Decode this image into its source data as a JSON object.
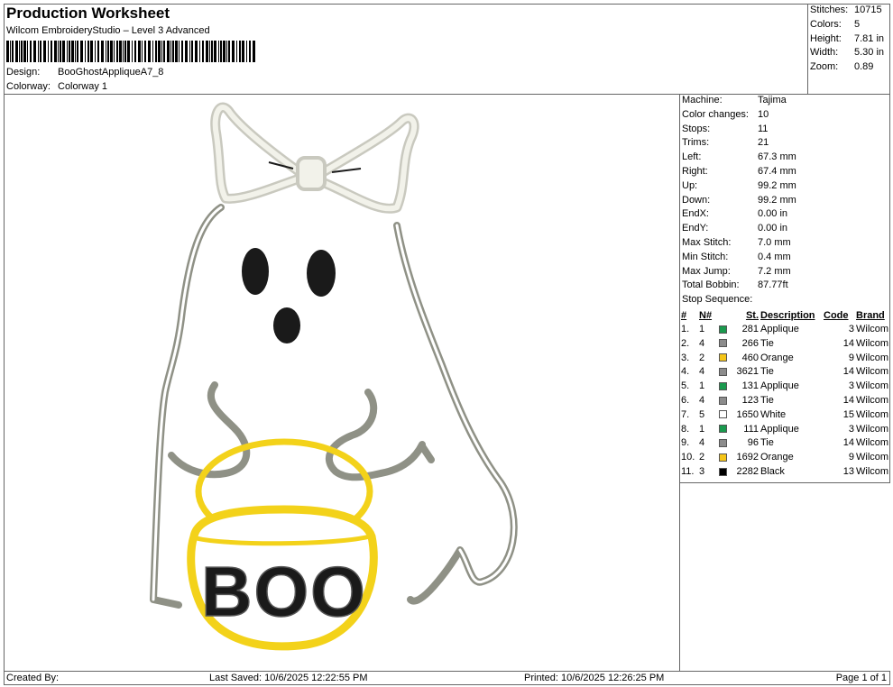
{
  "header": {
    "title": "Production Worksheet",
    "software": "Wilcom EmbroideryStudio – Level 3 Advanced",
    "design_label": "Design:",
    "design_value": "BooGhostAppliqueA7_8",
    "colorway_label": "Colorway:",
    "colorway_value": "Colorway 1"
  },
  "summary": [
    {
      "label": "Stitches:",
      "value": "10715"
    },
    {
      "label": "Colors:",
      "value": "5"
    },
    {
      "label": "Height:",
      "value": "7.81 in"
    },
    {
      "label": "Width:",
      "value": "5.30 in"
    },
    {
      "label": "Zoom:",
      "value": "0.89"
    }
  ],
  "machine_info": [
    {
      "label": "Machine:",
      "value": "Tajima"
    },
    {
      "label": "Color changes:",
      "value": "10"
    },
    {
      "label": "Stops:",
      "value": "11"
    },
    {
      "label": "Trims:",
      "value": "21"
    },
    {
      "label": "Left:",
      "value": "67.3 mm"
    },
    {
      "label": "Right:",
      "value": "67.4 mm"
    },
    {
      "label": "Up:",
      "value": "99.2 mm"
    },
    {
      "label": "Down:",
      "value": "99.2 mm"
    },
    {
      "label": "EndX:",
      "value": "0.00 in"
    },
    {
      "label": "EndY:",
      "value": "0.00 in"
    },
    {
      "label": "Max Stitch:",
      "value": "7.0 mm"
    },
    {
      "label": "Min Stitch:",
      "value": "0.4 mm"
    },
    {
      "label": "Max Jump:",
      "value": "7.2 mm"
    },
    {
      "label": "Total Bobbin:",
      "value": "87.77ft"
    }
  ],
  "stop_sequence": {
    "title": "Stop Sequence:",
    "headers": {
      "num": "#",
      "n": "N#",
      "st": "St.",
      "desc": "Description",
      "code": "Code",
      "brand": "Brand"
    },
    "rows": [
      {
        "num": "1.",
        "n": "1",
        "color": "#1a9a4e",
        "st": "281",
        "desc": "Applique",
        "code": "3",
        "brand": "Wilcom"
      },
      {
        "num": "2.",
        "n": "4",
        "color": "#8c8c8c",
        "st": "266",
        "desc": "Tie",
        "code": "14",
        "brand": "Wilcom"
      },
      {
        "num": "3.",
        "n": "2",
        "color": "#f5c518",
        "st": "460",
        "desc": "Orange",
        "code": "9",
        "brand": "Wilcom"
      },
      {
        "num": "4.",
        "n": "4",
        "color": "#8c8c8c",
        "st": "3621",
        "desc": "Tie",
        "code": "14",
        "brand": "Wilcom"
      },
      {
        "num": "5.",
        "n": "1",
        "color": "#1a9a4e",
        "st": "131",
        "desc": "Applique",
        "code": "3",
        "brand": "Wilcom"
      },
      {
        "num": "6.",
        "n": "4",
        "color": "#8c8c8c",
        "st": "123",
        "desc": "Tie",
        "code": "14",
        "brand": "Wilcom"
      },
      {
        "num": "7.",
        "n": "5",
        "color": "#ffffff",
        "st": "1650",
        "desc": "White",
        "code": "15",
        "brand": "Wilcom"
      },
      {
        "num": "8.",
        "n": "1",
        "color": "#1a9a4e",
        "st": "111",
        "desc": "Applique",
        "code": "3",
        "brand": "Wilcom"
      },
      {
        "num": "9.",
        "n": "4",
        "color": "#8c8c8c",
        "st": "96",
        "desc": "Tie",
        "code": "14",
        "brand": "Wilcom"
      },
      {
        "num": "10.",
        "n": "2",
        "color": "#f5c518",
        "st": "1692",
        "desc": "Orange",
        "code": "9",
        "brand": "Wilcom"
      },
      {
        "num": "11.",
        "n": "3",
        "color": "#000000",
        "st": "2282",
        "desc": "Black",
        "code": "13",
        "brand": "Wilcom"
      }
    ]
  },
  "design_text": "BOO",
  "footer": {
    "created_by": "Created By:",
    "last_saved": "Last Saved: 10/6/2025 12:22:55 PM",
    "printed": "Printed: 10/6/2025 12:26:25 PM",
    "page": "Page 1 of 1"
  },
  "colors": {
    "outline_gray": "#8f9186",
    "bow_white": "#f2f2ea",
    "yellow": "#f3d21a",
    "black": "#1a1a1a"
  }
}
